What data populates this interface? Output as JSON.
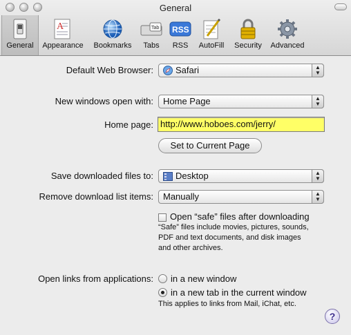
{
  "window": {
    "title": "General"
  },
  "toolbar": {
    "items": [
      {
        "label": "General",
        "icon": "switch-icon"
      },
      {
        "label": "Appearance",
        "icon": "appearance-icon"
      },
      {
        "label": "Bookmarks",
        "icon": "globe-icon"
      },
      {
        "label": "Tabs",
        "icon": "tabs-icon"
      },
      {
        "label": "RSS",
        "icon": "rss-icon"
      },
      {
        "label": "AutoFill",
        "icon": "autofill-icon"
      },
      {
        "label": "Security",
        "icon": "lock-icon"
      },
      {
        "label": "Advanced",
        "icon": "gear-icon"
      }
    ],
    "tabs_icon_text": "Tab",
    "rss_icon_text": "RSS"
  },
  "form": {
    "default_browser_label": "Default Web Browser:",
    "default_browser_value": "Safari",
    "new_windows_label": "New windows open with:",
    "new_windows_value": "Home Page",
    "home_page_label": "Home page:",
    "home_page_value": "http://www.hoboes.com/jerry/",
    "set_current_label": "Set to Current Page",
    "save_downloads_label": "Save downloaded files to:",
    "save_downloads_value": "Desktop",
    "remove_downloads_label": "Remove download list items:",
    "remove_downloads_value": "Manually",
    "open_safe_label": "Open “safe” files after downloading",
    "open_safe_checked": false,
    "safe_note_lines": [
      "“Safe” files include movies, pictures, sounds,",
      "PDF and text documents, and disk images",
      "and other archives."
    ],
    "open_links_label": "Open links from applications:",
    "open_links_options": [
      "in a new window",
      "in a new tab in the current window"
    ],
    "open_links_selected": "in a new tab in the current window",
    "links_note": "This applies to links from Mail, iChat, etc."
  },
  "help": {
    "label": "?"
  },
  "colors": {
    "home_field_bg": "#ffff66",
    "help_accent": "#3b2b8c"
  }
}
